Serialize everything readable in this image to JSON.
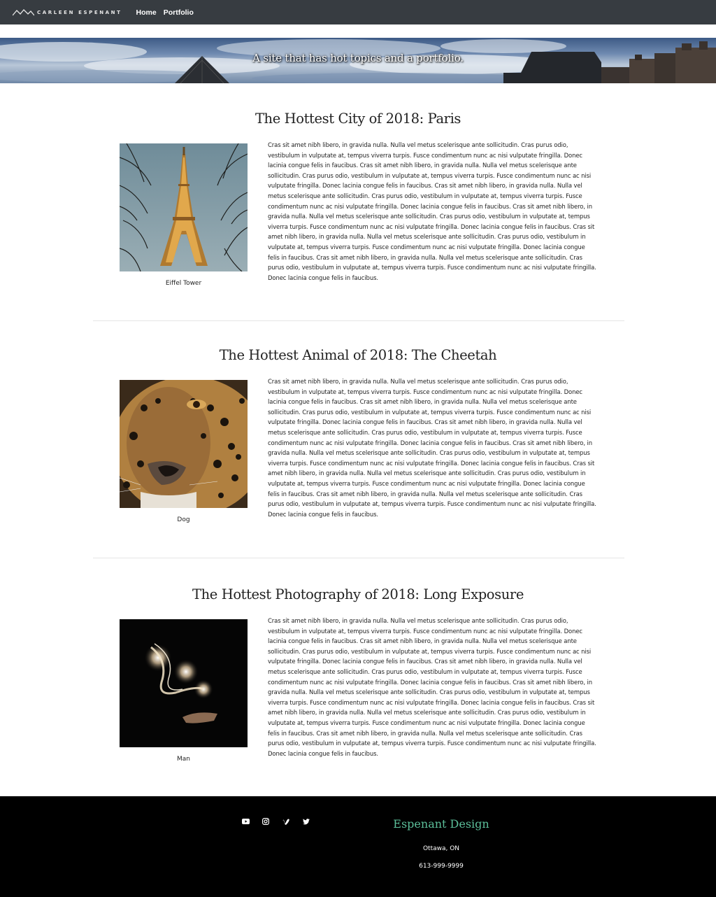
{
  "nav": {
    "brand": "CARLEEN ESPENANT",
    "links": [
      "Home",
      "Portfolio"
    ]
  },
  "hero": {
    "tagline": "A site that has hot topics and a portfolio."
  },
  "articles": [
    {
      "title": "The Hottest City of 2018: Paris",
      "caption": "Eiffel Tower",
      "image": "eiffel-tower-photo",
      "body": "Cras sit amet nibh libero, in gravida nulla. Nulla vel metus scelerisque ante sollicitudin. Cras purus odio, vestibulum in vulputate at, tempus viverra turpis. Fusce condimentum nunc ac nisi vulputate fringilla. Donec lacinia congue felis in faucibus. Cras sit amet nibh libero, in gravida nulla. Nulla vel metus scelerisque ante sollicitudin. Cras purus odio, vestibulum in vulputate at, tempus viverra turpis. Fusce condimentum nunc ac nisi vulputate fringilla. Donec lacinia congue felis in faucibus. Cras sit amet nibh libero, in gravida nulla. Nulla vel metus scelerisque ante sollicitudin. Cras purus odio, vestibulum in vulputate at, tempus viverra turpis. Fusce condimentum nunc ac nisi vulputate fringilla. Donec lacinia congue felis in faucibus. Cras sit amet nibh libero, in gravida nulla. Nulla vel metus scelerisque ante sollicitudin. Cras purus odio, vestibulum in vulputate at, tempus viverra turpis. Fusce condimentum nunc ac nisi vulputate fringilla. Donec lacinia congue felis in faucibus. Cras sit amet nibh libero, in gravida nulla. Nulla vel metus scelerisque ante sollicitudin. Cras purus odio, vestibulum in vulputate at, tempus viverra turpis. Fusce condimentum nunc ac nisi vulputate fringilla. Donec lacinia congue felis in faucibus. Cras sit amet nibh libero, in gravida nulla. Nulla vel metus scelerisque ante sollicitudin. Cras purus odio, vestibulum in vulputate at, tempus viverra turpis. Fusce condimentum nunc ac nisi vulputate fringilla. Donec lacinia congue felis in faucibus."
    },
    {
      "title": "The Hottest Animal of 2018: The Cheetah",
      "caption": "Dog",
      "image": "cheetah-photo",
      "body": "Cras sit amet nibh libero, in gravida nulla. Nulla vel metus scelerisque ante sollicitudin. Cras purus odio, vestibulum in vulputate at, tempus viverra turpis. Fusce condimentum nunc ac nisi vulputate fringilla. Donec lacinia congue felis in faucibus. Cras sit amet nibh libero, in gravida nulla. Nulla vel metus scelerisque ante sollicitudin. Cras purus odio, vestibulum in vulputate at, tempus viverra turpis. Fusce condimentum nunc ac nisi vulputate fringilla. Donec lacinia congue felis in faucibus. Cras sit amet nibh libero, in gravida nulla. Nulla vel metus scelerisque ante sollicitudin. Cras purus odio, vestibulum in vulputate at, tempus viverra turpis. Fusce condimentum nunc ac nisi vulputate fringilla. Donec lacinia congue felis in faucibus. Cras sit amet nibh libero, in gravida nulla. Nulla vel metus scelerisque ante sollicitudin. Cras purus odio, vestibulum in vulputate at, tempus viverra turpis. Fusce condimentum nunc ac nisi vulputate fringilla. Donec lacinia congue felis in faucibus. Cras sit amet nibh libero, in gravida nulla. Nulla vel metus scelerisque ante sollicitudin. Cras purus odio, vestibulum in vulputate at, tempus viverra turpis. Fusce condimentum nunc ac nisi vulputate fringilla. Donec lacinia congue felis in faucibus. Cras sit amet nibh libero, in gravida nulla. Nulla vel metus scelerisque ante sollicitudin. Cras purus odio, vestibulum in vulputate at, tempus viverra turpis. Fusce condimentum nunc ac nisi vulputate fringilla. Donec lacinia congue felis in faucibus."
    },
    {
      "title": "The Hottest Photography of 2018: Long Exposure",
      "caption": "Man",
      "image": "long-exposure-photo",
      "body": "Cras sit amet nibh libero, in gravida nulla. Nulla vel metus scelerisque ante sollicitudin. Cras purus odio, vestibulum in vulputate at, tempus viverra turpis. Fusce condimentum nunc ac nisi vulputate fringilla. Donec lacinia congue felis in faucibus. Cras sit amet nibh libero, in gravida nulla. Nulla vel metus scelerisque ante sollicitudin. Cras purus odio, vestibulum in vulputate at, tempus viverra turpis. Fusce condimentum nunc ac nisi vulputate fringilla. Donec lacinia congue felis in faucibus. Cras sit amet nibh libero, in gravida nulla. Nulla vel metus scelerisque ante sollicitudin. Cras purus odio, vestibulum in vulputate at, tempus viverra turpis. Fusce condimentum nunc ac nisi vulputate fringilla. Donec lacinia congue felis in faucibus. Cras sit amet nibh libero, in gravida nulla. Nulla vel metus scelerisque ante sollicitudin. Cras purus odio, vestibulum in vulputate at, tempus viverra turpis. Fusce condimentum nunc ac nisi vulputate fringilla. Donec lacinia congue felis in faucibus. Cras sit amet nibh libero, in gravida nulla. Nulla vel metus scelerisque ante sollicitudin. Cras purus odio, vestibulum in vulputate at, tempus viverra turpis. Fusce condimentum nunc ac nisi vulputate fringilla. Donec lacinia congue felis in faucibus. Cras sit amet nibh libero, in gravida nulla. Nulla vel metus scelerisque ante sollicitudin. Cras purus odio, vestibulum in vulputate at, tempus viverra turpis. Fusce condimentum nunc ac nisi vulputate fringilla. Donec lacinia congue felis in faucibus."
    }
  ],
  "footer": {
    "social_icons": [
      "youtube-icon",
      "instagram-icon",
      "vimeo-icon",
      "twitter-icon"
    ],
    "title": "Espenant Design",
    "city": "Ottawa, ON",
    "phone": "613-999-9999"
  },
  "colors": {
    "navbar": "#373c41",
    "footer": "#000000",
    "accent": "#5cbf9a"
  }
}
